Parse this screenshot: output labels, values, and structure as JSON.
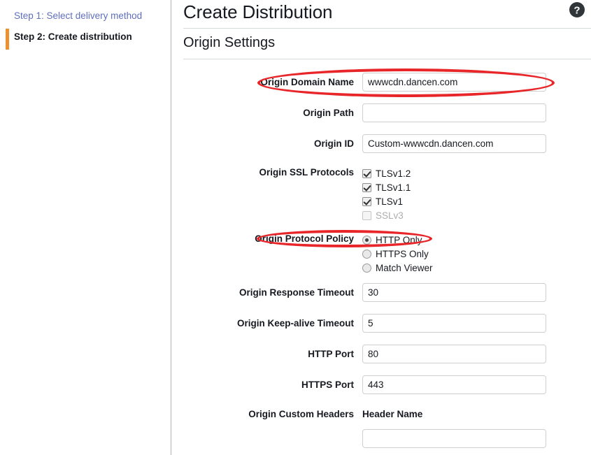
{
  "sidebar": {
    "steps": [
      {
        "label": "Step 1: Select delivery method",
        "state": "link"
      },
      {
        "label": "Step 2: Create distribution",
        "state": "current"
      }
    ]
  },
  "header": {
    "title": "Create Distribution",
    "help_icon": "help-circle-icon"
  },
  "section": {
    "title": "Origin Settings"
  },
  "form": {
    "origin_domain_name": {
      "label": "Origin Domain Name",
      "value": "wwwcdn.dancen.com",
      "placeholder": ""
    },
    "origin_path": {
      "label": "Origin Path",
      "value": "",
      "placeholder": ""
    },
    "origin_id": {
      "label": "Origin ID",
      "value": "Custom-wwwcdn.dancen.com",
      "placeholder": ""
    },
    "origin_ssl_protocols": {
      "label": "Origin SSL Protocols",
      "options": [
        {
          "label": "TLSv1.2",
          "checked": true,
          "disabled": false
        },
        {
          "label": "TLSv1.1",
          "checked": true,
          "disabled": false
        },
        {
          "label": "TLSv1",
          "checked": true,
          "disabled": false
        },
        {
          "label": "SSLv3",
          "checked": false,
          "disabled": true
        }
      ]
    },
    "origin_protocol_policy": {
      "label": "Origin Protocol Policy",
      "options": [
        {
          "label": "HTTP Only",
          "selected": true
        },
        {
          "label": "HTTPS Only",
          "selected": false
        },
        {
          "label": "Match Viewer",
          "selected": false
        }
      ]
    },
    "origin_response_timeout": {
      "label": "Origin Response Timeout",
      "value": "30",
      "placeholder": ""
    },
    "origin_keepalive_timeout": {
      "label": "Origin Keep-alive Timeout",
      "value": "5",
      "placeholder": ""
    },
    "http_port": {
      "label": "HTTP Port",
      "value": "80",
      "placeholder": ""
    },
    "https_port": {
      "label": "HTTPS Port",
      "value": "443",
      "placeholder": ""
    },
    "origin_custom_headers": {
      "label": "Origin Custom Headers",
      "column_header": "Header Name",
      "value": "",
      "placeholder": ""
    }
  },
  "annotations": {
    "color": "#e8262a",
    "shapes": [
      {
        "name": "origin-domain-name-highlight"
      },
      {
        "name": "origin-protocol-policy-highlight"
      }
    ]
  }
}
